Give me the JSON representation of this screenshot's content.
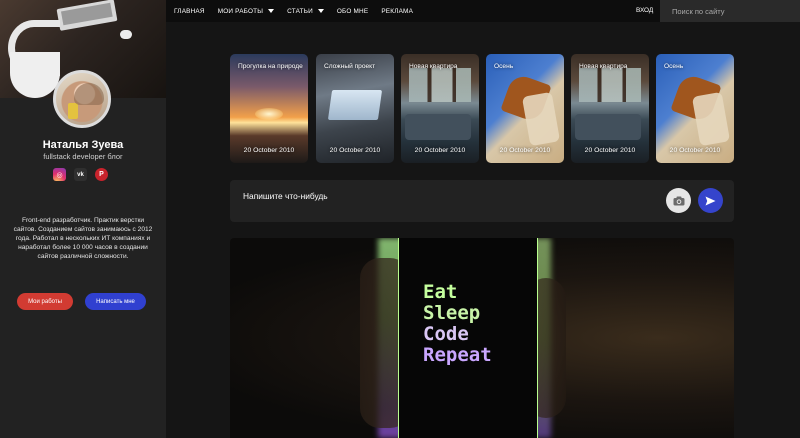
{
  "nav": {
    "items": [
      {
        "label": "ГЛАВНАЯ",
        "dropdown": false
      },
      {
        "label": "МОИ РАБОТЫ",
        "dropdown": true
      },
      {
        "label": "СТАТЬИ",
        "dropdown": true
      },
      {
        "label": "ОБО МНЕ",
        "dropdown": false
      },
      {
        "label": "РЕКЛАМА",
        "dropdown": false
      }
    ],
    "login_label": "ВХОД",
    "search_placeholder": "Поиск по сайту"
  },
  "profile": {
    "name": "Наталья Зуева",
    "subtitle": "fullstack developer блог",
    "socials": [
      {
        "icon": "instagram-icon",
        "glyph": "◎"
      },
      {
        "icon": "vk-icon",
        "glyph": "vk"
      },
      {
        "icon": "pinterest-icon",
        "glyph": "P"
      }
    ],
    "bio": "Front-end разработчик. Практик верстки сайтов. Созданием сайтов занимаюсь с 2012 года. Работал в нескольких ИТ компаниях и наработал более 10 000 часов в создании сайтов различной сложности.",
    "buttons": {
      "works": "Мои работы",
      "write": "Написать мне"
    }
  },
  "stories": [
    {
      "title": "Прогулка на природе",
      "date": "20 October 2010"
    },
    {
      "title": "Сложный проект",
      "date": "20 October 2010"
    },
    {
      "title": "Новая квартира",
      "date": "20 October 2010"
    },
    {
      "title": "Осень",
      "date": "20 October 2010"
    },
    {
      "title": "Новая квартира",
      "date": "20 October 2010"
    },
    {
      "title": "Осень",
      "date": "20 October 2010"
    }
  ],
  "post": {
    "placeholder": "Напишите что-нибудь",
    "camera_icon": "camera-icon",
    "send_icon": "send-icon"
  },
  "hero": {
    "lines": [
      "Eat",
      "Sleep",
      "Code",
      "Repeat"
    ]
  },
  "colors": {
    "accent_red": "#d23b32",
    "accent_blue": "#3544cc",
    "background": "#151515",
    "sidebar": "#222222"
  }
}
